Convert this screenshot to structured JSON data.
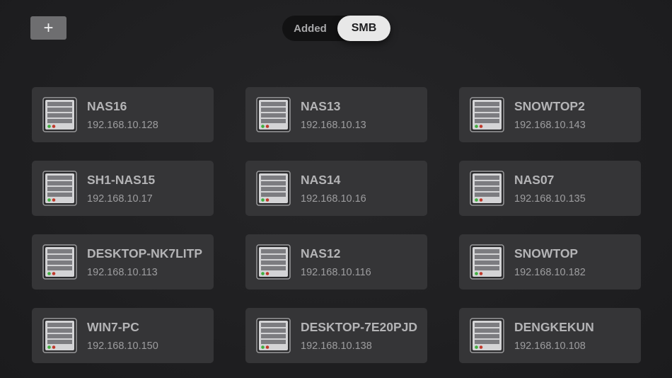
{
  "toolbar": {
    "add_label": "+"
  },
  "segments": {
    "added_label": "Added",
    "smb_label": "SMB",
    "selected": "SMB"
  },
  "colors": {
    "card_bg": "#353537",
    "led_green": "#3fae3f",
    "led_red": "#c0392b"
  },
  "devices": [
    {
      "name": "NAS16",
      "ip": "192.168.10.128",
      "icon": "server-icon"
    },
    {
      "name": "NAS13",
      "ip": "192.168.10.13",
      "icon": "server-icon"
    },
    {
      "name": "SNOWTOP2",
      "ip": "192.168.10.143",
      "icon": "server-icon"
    },
    {
      "name": "SH1-NAS15",
      "ip": "192.168.10.17",
      "icon": "server-icon"
    },
    {
      "name": "NAS14",
      "ip": "192.168.10.16",
      "icon": "server-icon"
    },
    {
      "name": "NAS07",
      "ip": "192.168.10.135",
      "icon": "server-icon"
    },
    {
      "name": "DESKTOP-NK7LITP",
      "ip": "192.168.10.113",
      "icon": "server-icon"
    },
    {
      "name": "NAS12",
      "ip": "192.168.10.116",
      "icon": "server-icon"
    },
    {
      "name": "SNOWTOP",
      "ip": "192.168.10.182",
      "icon": "server-icon"
    },
    {
      "name": "WIN7-PC",
      "ip": "192.168.10.150",
      "icon": "server-icon"
    },
    {
      "name": "DESKTOP-7E20PJD",
      "ip": "192.168.10.138",
      "icon": "server-icon"
    },
    {
      "name": "DENGKEKUN",
      "ip": "192.168.10.108",
      "icon": "server-icon"
    }
  ]
}
